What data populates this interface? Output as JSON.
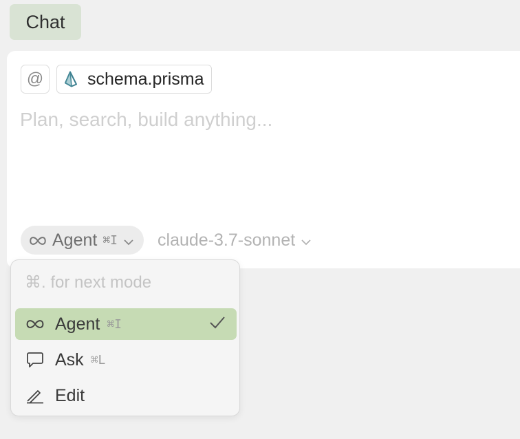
{
  "header": {
    "chat_tab_label": "Chat"
  },
  "composer": {
    "at_symbol": "@",
    "context_file": {
      "name": "schema.prisma",
      "icon": "prisma-icon"
    },
    "input": {
      "value": "",
      "placeholder": "Plan, search, build anything..."
    },
    "mode_button": {
      "icon": "infinity-icon",
      "label": "Agent",
      "shortcut": "⌘I"
    },
    "model_select": {
      "label": "claude-3.7-sonnet"
    }
  },
  "mode_menu": {
    "hint": "⌘. for next mode",
    "items": [
      {
        "label": "Agent",
        "shortcut": "⌘I",
        "icon": "infinity-icon",
        "selected": true
      },
      {
        "label": "Ask",
        "shortcut": "⌘L",
        "icon": "speech-bubble-icon",
        "selected": false
      },
      {
        "label": "Edit",
        "shortcut": "",
        "icon": "pencil-icon",
        "selected": false
      }
    ]
  },
  "colors": {
    "background": "#f0f0f0",
    "chat_tab": "#d9e3d4",
    "selected_item": "#c6dbb4",
    "placeholder": "#cfcfcf"
  }
}
